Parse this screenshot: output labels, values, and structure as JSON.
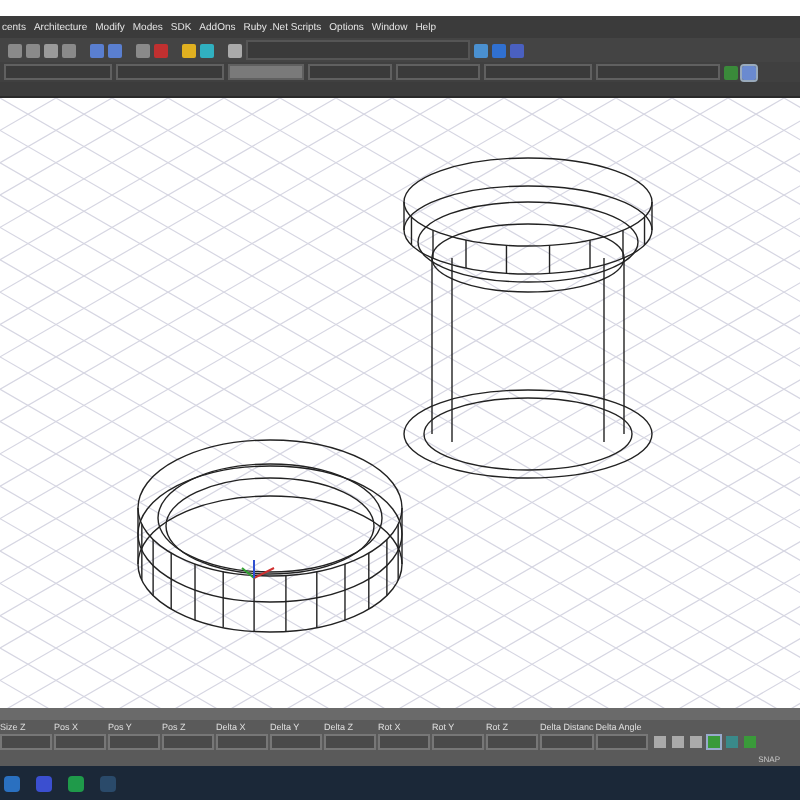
{
  "menu": [
    "cents",
    "Architecture",
    "Modify",
    "Modes",
    "SDK",
    "AddOns",
    "Ruby .Net Scripts",
    "Options",
    "Window",
    "Help"
  ],
  "fields": [
    "Size Z",
    "Pos X",
    "Pos Y",
    "Pos Z",
    "Delta X",
    "Delta Y",
    "Delta Z",
    "Rot X",
    "Rot Y",
    "Rot Z",
    "Delta Distanc",
    "Delta Angle"
  ],
  "status_bar": {
    "snap": "SNAP"
  }
}
